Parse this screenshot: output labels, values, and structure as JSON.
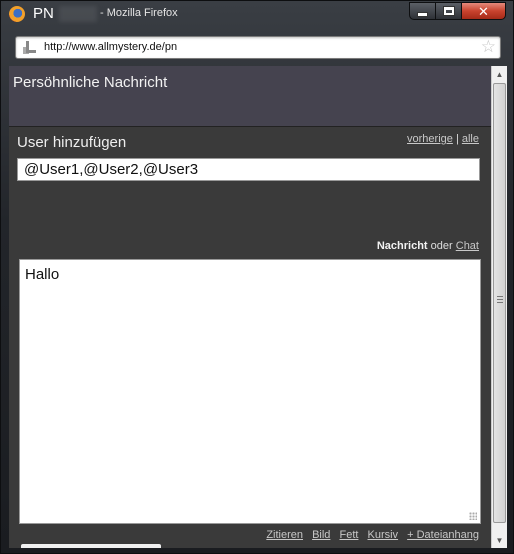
{
  "window": {
    "tab_title": "PN",
    "app_name": "- Mozilla Firefox",
    "buttons": {
      "minimize": "",
      "maximize": "",
      "close": "✕"
    }
  },
  "urlbar": {
    "url": "http://www.allmystery.de/pn"
  },
  "page": {
    "header_title": "Persöhnliche Nachricht",
    "user_section": {
      "label": "User hinzufügen",
      "link_prev": "vorherige",
      "separator": "|",
      "link_all": "alle",
      "input_value": "@User1,@User2,@User3"
    },
    "message_switch": {
      "active": "Nachricht",
      "or": "oder",
      "link_chat": "Chat"
    },
    "message_text": "Hallo",
    "toolbar": {
      "quote": "Zitieren",
      "image": "Bild",
      "bold": "Fett",
      "italic": "Kursiv",
      "attachment": "+ Dateianhang"
    }
  },
  "icons": [
    "firefox-logo-icon",
    "site-identity-icon",
    "bookmark-star-icon",
    "scroll-up-icon",
    "scroll-down-icon"
  ]
}
